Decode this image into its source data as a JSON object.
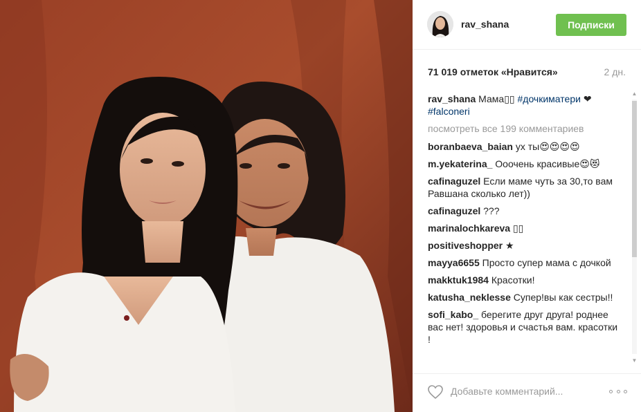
{
  "post": {
    "image_alt": "",
    "header": {
      "username": "rav_shana",
      "follow_label": "Подписки"
    },
    "likes_text": "71 019 отметок «Нравится»",
    "age": "2 дн.",
    "caption": {
      "username": "rav_shana",
      "text": "Мама▯▯",
      "tag1": "#дочкиматери",
      "emoji": "❤",
      "tag2": "#falconeri"
    },
    "view_all": "посмотреть все 199 комментариев",
    "comments": [
      {
        "user": "boranbaeva_baian",
        "text": "ух ты😍😍😍😍"
      },
      {
        "user": "m.yekaterina_",
        "text": "Ооочень красивые😍😻"
      },
      {
        "user": "cafinaguzel",
        "text": "Если маме чуть за 30,то вам Равшана сколько лет))"
      },
      {
        "user": "cafinaguzel",
        "text": "???"
      },
      {
        "user": "marinalochkareva",
        "text": "▯▯"
      },
      {
        "user": "positiveshopper",
        "text": "★"
      },
      {
        "user": "mayya6655",
        "text": "Просто супер мама с дочкой"
      },
      {
        "user": "makktuk1984",
        "text": "Красотки!"
      },
      {
        "user": "katusha_neklesse",
        "text": "Супер!вы как сестры!!"
      },
      {
        "user": "sofi_kabo_",
        "text": "берегите друг друга! роднее вас нет! здоровья и счастья вам. красотки !"
      }
    ],
    "footer": {
      "add_comment_placeholder": "Добавьте комментарий...",
      "heart_icon": "heart-icon",
      "more_icon": "more-options-icon"
    },
    "colors": {
      "follow_button": "#70c050",
      "hashtag": "#003569",
      "muted": "#999999"
    }
  }
}
